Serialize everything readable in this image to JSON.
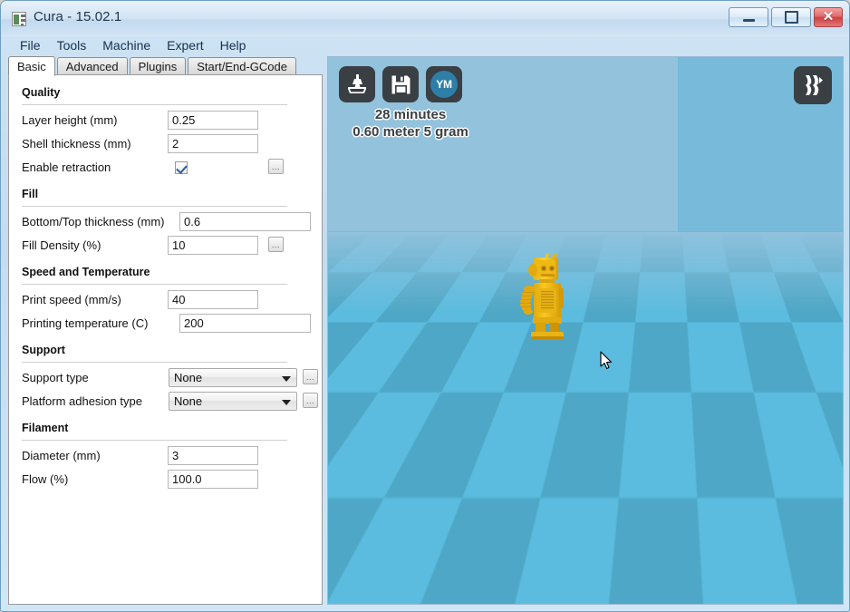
{
  "window": {
    "title": "Cura - 15.02.1",
    "app_icon": "cura-icon",
    "controls": {
      "minimize": "–",
      "maximize": "□",
      "close": "✕"
    }
  },
  "menubar": {
    "items": [
      {
        "label": "File"
      },
      {
        "label": "Tools"
      },
      {
        "label": "Machine"
      },
      {
        "label": "Expert"
      },
      {
        "label": "Help"
      }
    ]
  },
  "tabs": [
    {
      "label": "Basic",
      "active": true
    },
    {
      "label": "Advanced",
      "active": false
    },
    {
      "label": "Plugins",
      "active": false
    },
    {
      "label": "Start/End-GCode",
      "active": false
    }
  ],
  "settings": {
    "groups": [
      {
        "title": "Quality",
        "rows": [
          {
            "label": "Layer height (mm)",
            "type": "text",
            "value": "0.25",
            "more": false
          },
          {
            "label": "Shell thickness (mm)",
            "type": "text",
            "value": "2",
            "more": false
          },
          {
            "label": "Enable retraction",
            "type": "checkbox",
            "checked": true,
            "more": true
          }
        ]
      },
      {
        "title": "Fill",
        "rows": [
          {
            "label": "Bottom/Top thickness (mm)",
            "type": "text",
            "value": "0.6",
            "more": false
          },
          {
            "label": "Fill Density (%)",
            "type": "text",
            "value": "10",
            "more": true
          }
        ]
      },
      {
        "title": "Speed and Temperature",
        "rows": [
          {
            "label": "Print speed (mm/s)",
            "type": "text",
            "value": "40",
            "more": false
          },
          {
            "label": "Printing temperature (C)",
            "type": "text",
            "value": "200",
            "more": false
          }
        ]
      },
      {
        "title": "Support",
        "rows": [
          {
            "label": "Support type",
            "type": "combo",
            "value": "None",
            "options": [
              "None"
            ],
            "more": true
          },
          {
            "label": "Platform adhesion type",
            "type": "combo",
            "value": "None",
            "options": [
              "None"
            ],
            "more": true
          }
        ]
      },
      {
        "title": "Filament",
        "rows": [
          {
            "label": "Diameter (mm)",
            "type": "text",
            "value": "3",
            "more": false
          },
          {
            "label": "Flow (%)",
            "type": "text",
            "value": "100.0",
            "more": false
          }
        ]
      }
    ],
    "more_button_label": "..."
  },
  "viewport": {
    "toolbar": [
      {
        "name": "load-model-button",
        "icon": "printer-platform-icon"
      },
      {
        "name": "save-toolpath-button",
        "icon": "floppy-disk-icon"
      },
      {
        "name": "share-youmagine-button",
        "icon": "youmagine-icon",
        "label": "YM"
      }
    ],
    "view_mode_button": {
      "name": "view-mode-button",
      "icon": "layers-view-icon"
    },
    "stats": {
      "time": "28 minutes",
      "material": "0.60 meter 5 gram"
    },
    "model_name": "ultimaker-robot-model",
    "colors": {
      "back_wall": "#92c2dc",
      "right_wall": "#77bada",
      "platform_light": "#5bbcdf",
      "platform_dark": "#4ea7c6",
      "model": "#f5c21e",
      "toolbar_button": "#3a3f44",
      "youmagine_accent": "#2e7fa8"
    }
  }
}
